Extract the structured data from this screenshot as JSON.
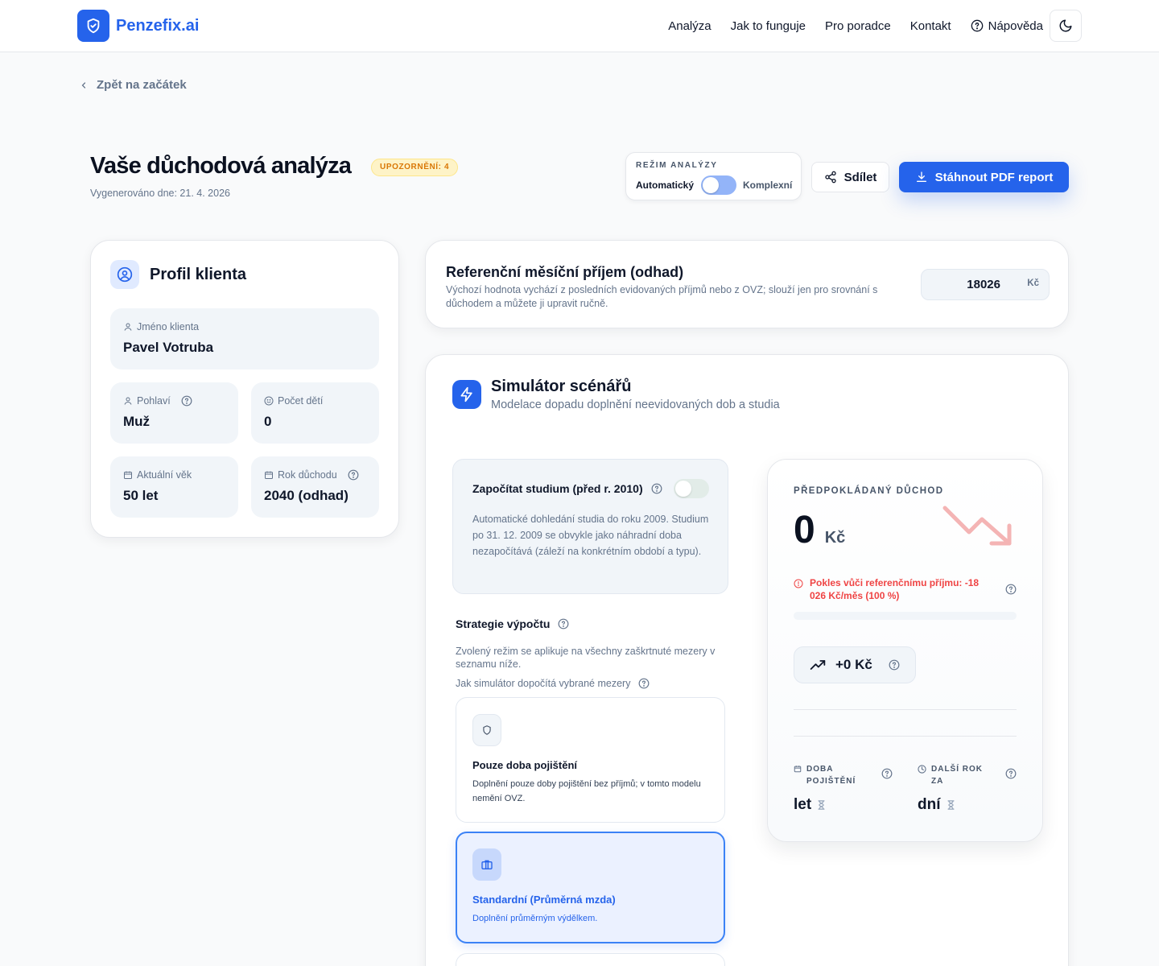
{
  "header": {
    "brand": "Penzefix.ai",
    "nav": [
      "Analýza",
      "Jak to funguje",
      "Pro poradce",
      "Kontakt"
    ],
    "help": "Nápověda"
  },
  "back": "Zpět na začátek",
  "title": {
    "heading": "Vaše důchodová analýza",
    "badge": "UPOZORNĚNÍ: 4",
    "generated": "Vygenerováno dne: 21. 4. 2026"
  },
  "mode": {
    "label": "REŽIM ANALÝZY",
    "left": "Automatický",
    "right": "Komplexní"
  },
  "actions": {
    "share": "Sdílet",
    "pdf": "Stáhnout PDF report"
  },
  "profile": {
    "title": "Profil klienta",
    "name_label": "Jméno klienta",
    "name": "Pavel Votruba",
    "gender_label": "Pohlaví",
    "gender": "Muž",
    "children_label": "Počet dětí",
    "children": "0",
    "age_label": "Aktuální věk",
    "age": "50 let",
    "retire_label": "Rok důchodu",
    "retire": "2040 (odhad)"
  },
  "reference": {
    "title": "Referenční měsíční příjem (odhad)",
    "desc": "Výchozí hodnota vychází z posledních evidovaných příjmů nebo z OVZ; slouží jen pro srovnání s důchodem a můžete ji upravit ručně.",
    "value": "18026",
    "unit": "Kč"
  },
  "simulator": {
    "title": "Simulátor scénářů",
    "subtitle": "Modelace dopadu doplnění neevidovaných dob a studia",
    "study_label": "Započítat studium (před r. 2010)",
    "study_desc": "Automatické dohledání studia do roku 2009. Studium po 31. 12. 2009 se obvykle jako náhradní doba nezapočítává (záleží na konkrétním období a typu).",
    "strategy_title": "Strategie výpočtu",
    "strategy_desc": "Zvolený režim se aplikuje na všechny zaškrtnuté mezery v seznamu níže.",
    "strategy_how": "Jak simulátor dopočítá vybrané mezery",
    "options": [
      {
        "title": "Pouze doba pojištění",
        "desc": "Doplnění pouze doby pojištění bez příjmů; v tomto modelu nemění OVZ."
      },
      {
        "title": "Standardní (Průměrná mzda)",
        "desc": "Doplnění průměrným výdělkem."
      }
    ]
  },
  "pension": {
    "label": "PŘEDPOKLÁDANÝ DŮCHOD",
    "amount": "0",
    "unit": "Kč",
    "drop": "Pokles vůči referenčnímu příjmu: -18 026 Kč/měs (100 %)",
    "gain": "+0 Kč",
    "stat1_label": "DOBA POJIŠTĚNÍ",
    "stat1_value": "let",
    "stat2_label": "DALŠÍ ROK ZA",
    "stat2_value": "dní",
    "colors": {
      "accent": "#2563eb",
      "danger": "#ef4444",
      "trend": "#f4a9a9"
    }
  }
}
